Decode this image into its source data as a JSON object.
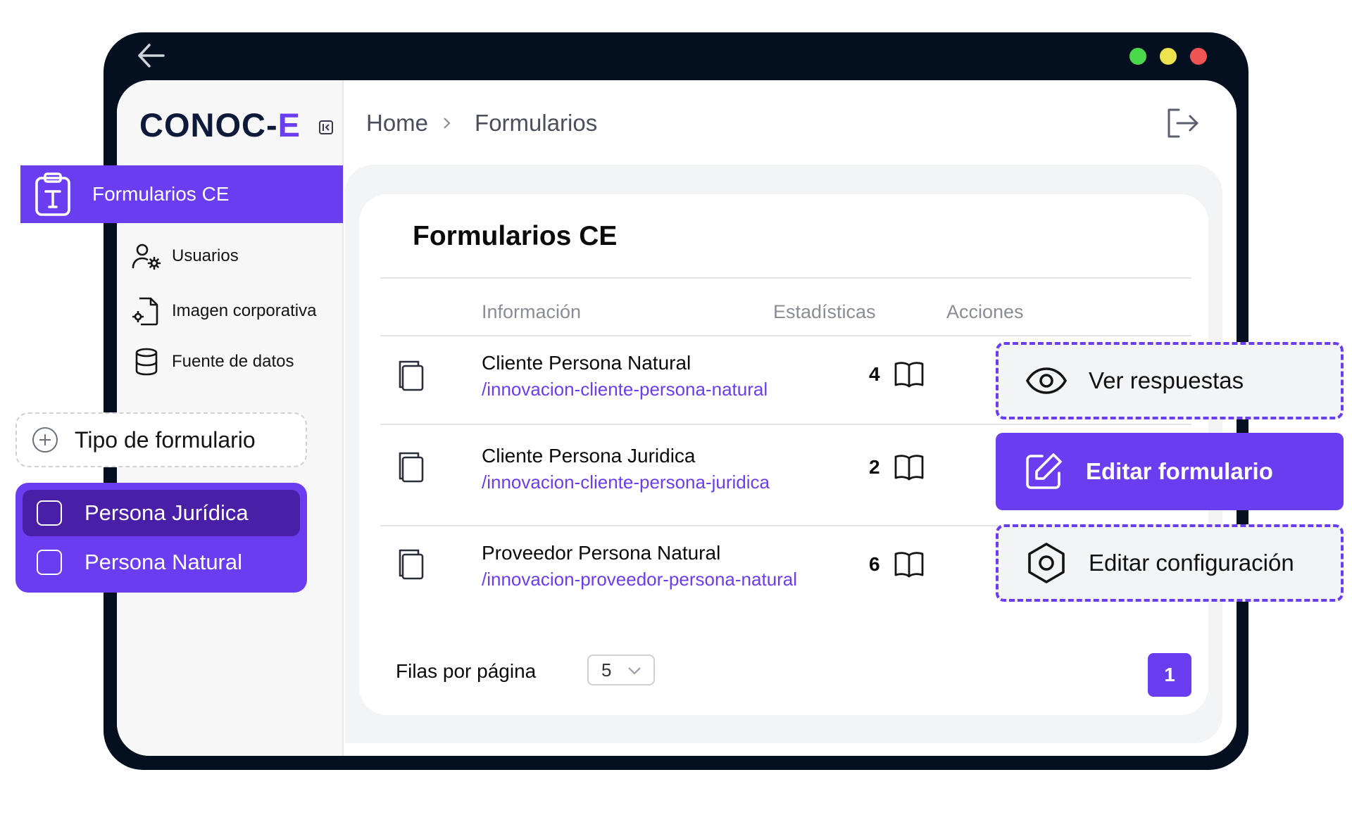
{
  "app": {
    "logo_main": "CONOC-",
    "logo_accent": "E"
  },
  "header": {
    "breadcrumb": [
      "Home",
      "Formularios"
    ]
  },
  "sidebar": {
    "active_item": "Formularios CE",
    "items": [
      {
        "label": "Usuarios",
        "icon": "user-gear-icon"
      },
      {
        "label": "Imagen corporativa",
        "icon": "file-gear-icon"
      },
      {
        "label": "Fuente de datos",
        "icon": "database-icon"
      }
    ]
  },
  "form_type": {
    "label": "Tipo de formulario",
    "options": [
      {
        "label": "Persona Jurídica",
        "selected": true
      },
      {
        "label": "Persona Natural",
        "selected": false
      }
    ]
  },
  "main": {
    "title": "Formularios CE",
    "columns": [
      "Información",
      "Estadísticas",
      "Acciones"
    ],
    "rows": [
      {
        "name": "Cliente Persona Natural",
        "path": "/innovacion-cliente-persona-natural",
        "count": "4"
      },
      {
        "name": "Cliente Persona Juridica",
        "path": "/innovacion-cliente-persona-juridica",
        "count": "2"
      },
      {
        "name": "Proveedor Persona Natural",
        "path": "/innovacion-proveedor-persona-natural",
        "count": "6"
      }
    ],
    "pagination": {
      "rows_label": "Filas por página",
      "rows_value": "5",
      "current_page": "1"
    }
  },
  "actions": {
    "view": "Ver respuestas",
    "edit_form": "Editar formulario",
    "edit_config": "Editar configuración"
  },
  "colors": {
    "accent": "#6a3df0",
    "frame": "#04101f",
    "dark_accent": "#4a1fa8"
  }
}
